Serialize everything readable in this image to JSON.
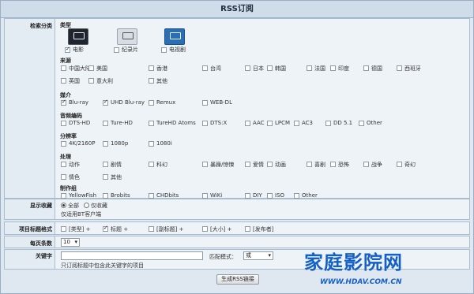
{
  "title": "RSS订阅",
  "category": {
    "label": "检索分类",
    "type_label": "类型",
    "types": [
      {
        "label": "电影",
        "checked": true,
        "icon": "movie-icon"
      },
      {
        "label": "纪录片",
        "checked": false,
        "icon": "documentary-icon"
      },
      {
        "label": "电视剧",
        "checked": false,
        "icon": "tv-icon"
      }
    ],
    "source_label": "来源",
    "sources_row1": [
      "中国大陆",
      "美国",
      "香港",
      "台湾",
      "日本",
      "韩国",
      "法国",
      "印度",
      "德国",
      "西班牙"
    ],
    "sources_row2": [
      "英国",
      "意大利",
      "其他"
    ],
    "media_label": "媒介",
    "media": [
      {
        "label": "Blu-ray",
        "checked": true
      },
      {
        "label": "UHD Blu-ray",
        "checked": true
      },
      {
        "label": "Remux",
        "checked": false
      },
      {
        "label": "WEB-DL",
        "checked": false
      }
    ],
    "audio_label": "音频编码",
    "audio": [
      "DTS-HD",
      "Ture-HD",
      "TureHD Atoms",
      "DTS:X",
      "AAC",
      "LPCM",
      "AC3",
      "DD 5.1",
      "Other"
    ],
    "resolution_label": "分辨率",
    "resolutions": [
      "4K/2160P",
      "1080p",
      "1080i"
    ],
    "genre_label": "处理",
    "genres_row1": [
      "动作",
      "剧情",
      "科幻",
      "暴躁/惊悚",
      "爱情",
      "动画",
      "喜剧",
      "恐怖",
      "战争",
      "奇幻"
    ],
    "genres_row2": [
      "情色",
      "其他"
    ],
    "group_label": "制作组",
    "groups": [
      "YellowFish",
      "Brobits",
      "CHDbits",
      "WiKi",
      "DIY",
      "ISO",
      "Other"
    ]
  },
  "display": {
    "label": "显示收藏",
    "options": [
      {
        "label": "全部",
        "selected": true
      },
      {
        "label": "仅收藏",
        "selected": false
      }
    ],
    "note": "仅适用BT客户端"
  },
  "title_format": {
    "label": "项目标题格式",
    "items": [
      {
        "label": "[类型] +",
        "checked": false
      },
      {
        "label": "标题 +",
        "checked": true
      },
      {
        "label": "[副标题] +",
        "checked": false
      },
      {
        "label": "[大小] +",
        "checked": false
      },
      {
        "label": "[发布者]",
        "checked": false
      }
    ]
  },
  "per_page": {
    "label": "每页条数",
    "value": "10"
  },
  "keyword": {
    "label": "关键字",
    "value": "",
    "match_label": "匹配模式：",
    "match_value": "或",
    "note": "只订阅标题中包含此关键字的项目"
  },
  "submit_label": "生成RSS链接",
  "watermark": {
    "cn": "家庭影院网",
    "url": "WWW.HDAV.COM.CN"
  }
}
